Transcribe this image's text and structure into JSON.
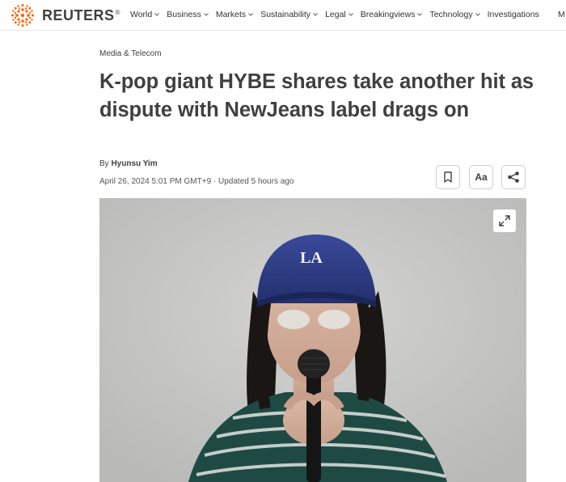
{
  "brand": {
    "name": "REUTERS",
    "registered": "®",
    "accent": "#fa6400"
  },
  "nav": {
    "items": [
      {
        "label": "World",
        "name": "nav-item-world"
      },
      {
        "label": "Business",
        "name": "nav-item-business"
      },
      {
        "label": "Markets",
        "name": "nav-item-markets"
      },
      {
        "label": "Sustainability",
        "name": "nav-item-sustainability"
      },
      {
        "label": "Legal",
        "name": "nav-item-legal"
      },
      {
        "label": "Breakingviews",
        "name": "nav-item-breakingviews"
      },
      {
        "label": "Technology",
        "name": "nav-item-technology"
      },
      {
        "label": "Investigations",
        "name": "nav-item-investigations"
      }
    ],
    "overflow_label": "M"
  },
  "article": {
    "kicker": "Media & Telecom",
    "headline": "K-pop giant HYBE shares take another hit as dispute with NewJeans label drags on",
    "byline_prefix": "By ",
    "author": "Hyunsu Yim",
    "dateline": "April 26, 2024 5:01 PM GMT+9 · Updated 5 hours ago",
    "font_button_label": "Aa"
  },
  "icons": {
    "logo": "reuters-logo-icon",
    "bookmark": "bookmark-icon",
    "share": "share-icon",
    "expand": "expand-icon",
    "chevron": "chevron-down-icon"
  },
  "image": {
    "cap_logo": "LA"
  }
}
